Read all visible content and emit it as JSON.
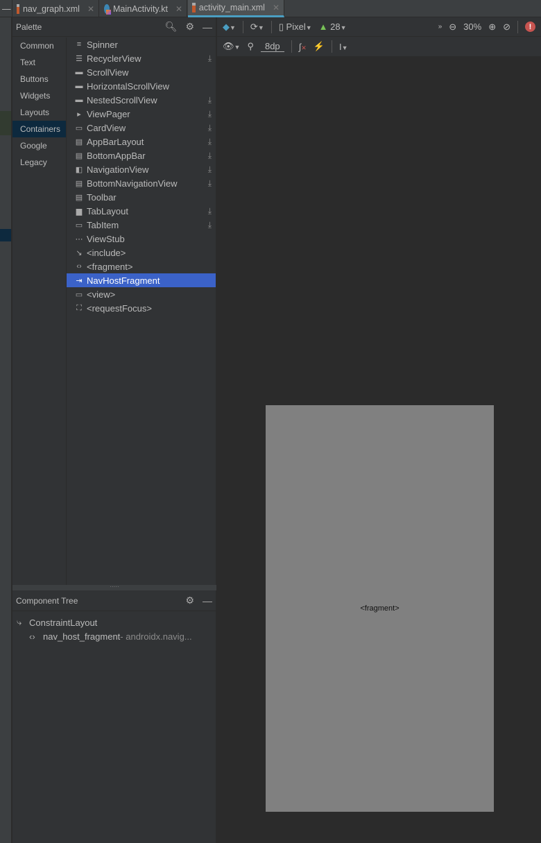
{
  "tabs": [
    {
      "label": "nav_graph.xml",
      "icon": "xml-file-icon"
    },
    {
      "label": "MainActivity.kt",
      "icon": "kotlin-file-icon"
    },
    {
      "label": "activity_main.xml",
      "icon": "xml-file-icon",
      "active": true
    }
  ],
  "palette": {
    "title": "Palette",
    "categories": [
      "Common",
      "Text",
      "Buttons",
      "Widgets",
      "Layouts",
      "Containers",
      "Google",
      "Legacy"
    ],
    "selected_category": "Containers",
    "items": [
      {
        "label": "Spinner",
        "icon": "≡",
        "download": false
      },
      {
        "label": "RecyclerView",
        "icon": "☰",
        "download": true
      },
      {
        "label": "ScrollView",
        "icon": "▬",
        "download": false
      },
      {
        "label": "HorizontalScrollView",
        "icon": "▬",
        "download": false
      },
      {
        "label": "NestedScrollView",
        "icon": "▬",
        "download": true
      },
      {
        "label": "ViewPager",
        "icon": "▸",
        "download": true
      },
      {
        "label": "CardView",
        "icon": "▭",
        "download": true
      },
      {
        "label": "AppBarLayout",
        "icon": "▤",
        "download": true
      },
      {
        "label": "BottomAppBar",
        "icon": "▤",
        "download": true
      },
      {
        "label": "NavigationView",
        "icon": "◧",
        "download": true
      },
      {
        "label": "BottomNavigationView",
        "icon": "▤",
        "download": true
      },
      {
        "label": "Toolbar",
        "icon": "▤",
        "download": false
      },
      {
        "label": "TabLayout",
        "icon": "▆",
        "download": true
      },
      {
        "label": "TabItem",
        "icon": "▭",
        "download": true
      },
      {
        "label": "ViewStub",
        "icon": "⋯",
        "download": false
      },
      {
        "label": "<include>",
        "icon": "↘",
        "download": false
      },
      {
        "label": "<fragment>",
        "icon": "‹›",
        "download": false
      },
      {
        "label": "NavHostFragment",
        "icon": "⇥",
        "download": false,
        "selected": true
      },
      {
        "label": "<view>",
        "icon": "▭",
        "download": false
      },
      {
        "label": "<requestFocus>",
        "icon": "⛶",
        "download": false
      }
    ]
  },
  "component_tree": {
    "title": "Component Tree",
    "root": "ConstraintLayout",
    "child_id": "nav_host_fragment",
    "child_class": "- androidx.navig..."
  },
  "toolbar": {
    "device": "Pixel",
    "api": "28",
    "zoom": "30%",
    "margin": "8dp"
  },
  "canvas": {
    "placeholder": "<fragment>"
  },
  "colors": {
    "selection": "#3b62c8",
    "accent": "#4a9ec2",
    "error": "#c75450",
    "android": "#78c257"
  }
}
